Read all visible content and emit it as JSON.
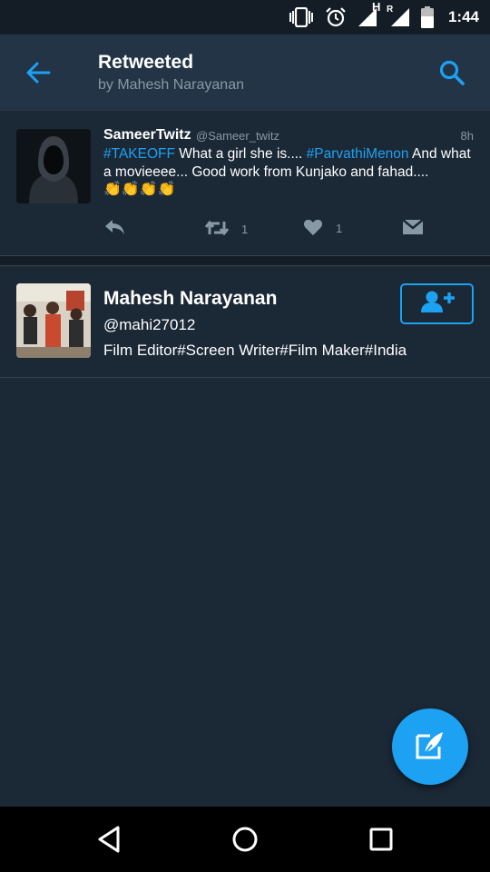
{
  "status_bar": {
    "time": "1:44",
    "network_label": "H",
    "roaming_label": "R",
    "icons": [
      "vibrate-icon",
      "alarm-icon",
      "signal-icon",
      "signal-roaming-icon",
      "battery-icon"
    ]
  },
  "header": {
    "title": "Retweeted",
    "subtitle": "by Mahesh Narayanan",
    "icons": [
      "back-arrow-icon",
      "search-icon"
    ]
  },
  "tweet": {
    "author_name": "SameerTwitz",
    "author_handle": "@Sameer_twitz",
    "time": "8h",
    "hashtag_1": "#TAKEOFF",
    "text_1": " What a girl she is.... ",
    "hashtag_2": "#ParvathiMenon",
    "text_2": " And what a movieeee... Good work from Kunjako and fahad....",
    "emoji": "👏👏👏👏",
    "retweet_count": "1",
    "like_count": "1",
    "icons": [
      "reply-icon",
      "retweet-icon",
      "heart-icon",
      "direct-message-icon"
    ]
  },
  "user_card": {
    "name": "Mahesh Narayanan",
    "handle": "@mahi27012",
    "bio": "Film Editor#Screen Writer#Film Maker#India",
    "follow_icon": "add-user-icon"
  },
  "fab": {
    "icon": "compose-tweet-icon"
  },
  "nav_bar": {
    "icons": [
      "back-triangle-icon",
      "home-circle-icon",
      "recents-square-icon"
    ]
  },
  "colors": {
    "background": "#1b2836",
    "header": "#243447",
    "accent": "#1da1f2",
    "muted": "#8899a6",
    "divider": "#38444d"
  }
}
